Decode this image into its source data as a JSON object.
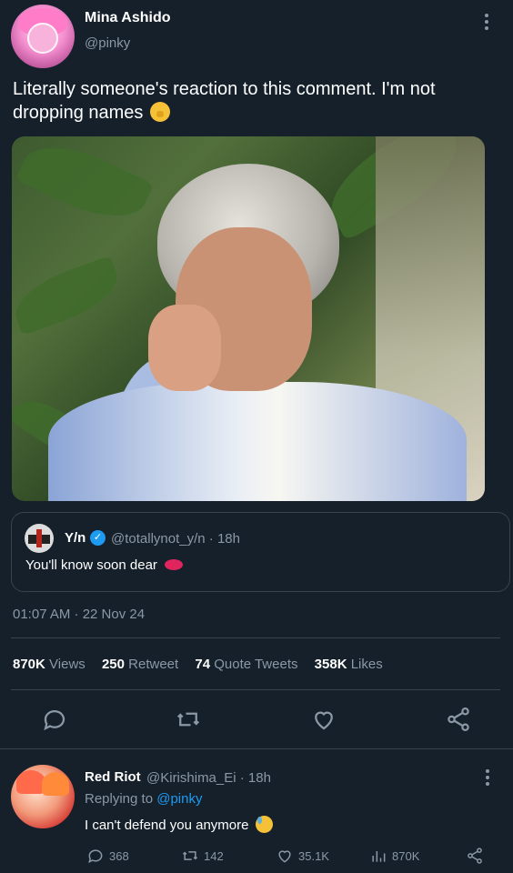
{
  "tweet": {
    "author_name": "Mina Ashido",
    "author_handle": "@pinky",
    "text": "Literally someone's reaction to this comment. I'm not dropping names",
    "emoji": "face-with-hand-over-mouth",
    "timestamp": "01:07 AM · 22 Nov 24"
  },
  "quote": {
    "name": "Y/n",
    "verified": true,
    "handle_time": "@totallynot_y/n · 18h",
    "text": "You'll know soon dear",
    "emoji": "kiss-mark"
  },
  "stats": {
    "views_count": "870K",
    "views_label": "Views",
    "retweets_count": "250",
    "retweets_label": "Retweet",
    "quotes_count": "74",
    "quotes_label": "Quote Tweets",
    "likes_count": "358K",
    "likes_label": "Likes"
  },
  "actions": [
    "reply-icon",
    "retweet-icon",
    "like-icon",
    "share-icon"
  ],
  "reply": {
    "name": "Red Riot",
    "handle_time": "@Kirishima_Ei · 18h",
    "replying_label": "Replying to",
    "replying_mention": "@pinky",
    "text": "I can't defend you anymore",
    "emoji": "downcast-face-with-sweat",
    "counts": {
      "replies": "368",
      "retweets": "142",
      "likes": "35.1K",
      "views": "870K"
    }
  },
  "colors": {
    "background": "#15202b",
    "muted": "#8b98a5",
    "accent": "#1d9bf0",
    "divider": "#38444d"
  }
}
